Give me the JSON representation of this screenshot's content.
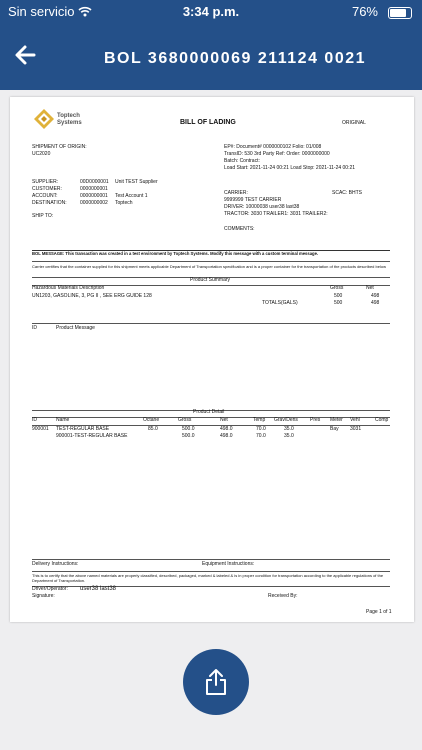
{
  "status": {
    "carrier": "Sin servicio",
    "time": "3:34 p.m.",
    "battery": "76%"
  },
  "nav": {
    "title": "BOL 3680000069 211124 0021"
  },
  "doc": {
    "logo_text": "Toptech Systems",
    "heading": "BILL OF LADING",
    "original": "ORIGINAL",
    "origin_label": "SHIPMENT OF ORIGIN:",
    "origin_value": "UC2020",
    "ep": "EP#:  Document# 0000000102  Folio: 01/008",
    "trans": "TransID: 530  3rd Party Ref:  Order:  0000000000",
    "batch": "Batch:  Contract:",
    "load": "Load Start: 2021-11-24 00:21  Load Stop: 2021-11-24 00:21",
    "parties": [
      {
        "label": "SUPPLIER:",
        "code": "00D0000001",
        "name": "Unit TEST Supplier"
      },
      {
        "label": "CUSTOMER:",
        "code": "0000000001",
        "name": ""
      },
      {
        "label": "ACCOUNT:",
        "code": "0000000001",
        "name": "Test Account 1"
      },
      {
        "label": "DESTINATION:",
        "code": "0000000002",
        "name": "Toptech"
      }
    ],
    "ship_to": "SHIP TO:",
    "carrier_label": "CARRIER:",
    "carrier_value": "9999999  TEST CARRIER",
    "scac": "SCAC: BHTS",
    "driver": "DRIVER:  10000038   user38  last38",
    "tractor": "TRACTOR: 3030 TRAILER1: 3031 TRAILER2:",
    "comments": "COMMENTS:",
    "bol_message": "BOL MESSAGE:  This transaction was created in  a test environment by Toptech Systems.  Modify this message with  a custom terminal message.",
    "certify": "Carrier certifies that the container supplied for this shipment meets applicable Department of Transportation specification and is a proper container for the transportation of the products described below",
    "product_summary": "Product Summary",
    "hazmat_header": "Hazardous Materials Description",
    "gross_h": "Gross",
    "net_h": "Net",
    "hazmat_line": "UN1203, GASOLINE, 3, PG II   ,   SEE ERG GUIDE 128",
    "haz_gross": "500",
    "haz_net": "498",
    "totals_label": "TOTALS(GALS)",
    "tot_gross": "500",
    "tot_net": "498",
    "id_h": "ID",
    "msg_h": "Product Message",
    "product_detail": "Product Detail",
    "detail_headers": [
      "ID",
      "Name",
      "Octane",
      "Gross",
      "Net",
      "Temp",
      "Grav/Dens",
      "Pres",
      "Meter",
      "Vehl",
      "Comp"
    ],
    "detail_rows": [
      [
        "900001",
        "TEST-REGULAR BASE",
        "85.0",
        "500.0",
        "498.0",
        "70.0",
        "35.0",
        "",
        "Bay",
        "3031",
        ""
      ],
      [
        "",
        "900001-TEST-REGULAR BASE",
        "",
        "500.0",
        "498.0",
        "70.0",
        "35.0",
        "",
        "",
        "",
        ""
      ]
    ],
    "delivery": "Delivery Instructions:",
    "equipment": "Equipment Instructions:",
    "certify2": "This is to certify that the above named materials are properly classified, described, packaged, marked & labeled & is in proper condition for transportation according to the applicable regulations of the Department of Transportation.",
    "driver_op": "Driver/Operator:",
    "driver_sig": "user38  last38",
    "signature": "Signature:",
    "received": "Received By:",
    "page": "Page 1 of 1"
  },
  "colors": {
    "brand": "#245089",
    "background": "#eeeef0"
  },
  "icons": {
    "back": "arrow-left-icon",
    "share": "share-icon",
    "wifi": "wifi-icon",
    "battery": "battery-icon"
  }
}
